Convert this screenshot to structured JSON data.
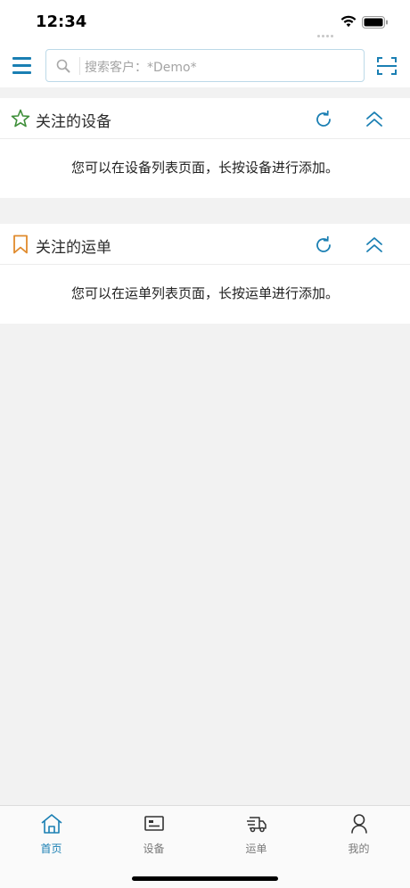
{
  "status_bar": {
    "time": "12:34"
  },
  "header": {
    "menu_icon": "hamburger-menu-icon",
    "search": {
      "placeholder": "搜索客户：*Demo*",
      "icon": "search-icon"
    },
    "scan_icon": "scan-icon"
  },
  "sections": [
    {
      "title": "关注的设备",
      "icon": "star-icon",
      "message": "您可以在设备列表页面，长按设备进行添加。"
    },
    {
      "title": "关注的运单",
      "icon": "bookmark-icon",
      "message": "您可以在运单列表页面，长按运单进行添加。"
    }
  ],
  "tabbar": {
    "tabs": [
      {
        "label": "首页",
        "icon": "home-icon",
        "active": true
      },
      {
        "label": "设备",
        "icon": "device-card-icon",
        "active": false
      },
      {
        "label": "运单",
        "icon": "truck-icon",
        "active": false
      },
      {
        "label": "我的",
        "icon": "user-icon",
        "active": false
      }
    ]
  },
  "colors": {
    "accent": "#1a7fb3",
    "star": "#3f8f3a",
    "bookmark": "#e08a2c",
    "background": "#f2f2f2"
  }
}
